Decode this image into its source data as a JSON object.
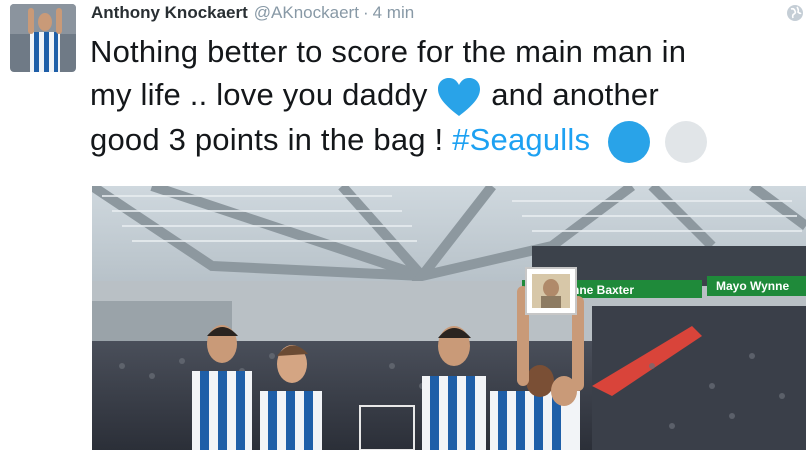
{
  "tweet": {
    "display_name": "Anthony Knockaert",
    "handle": "@AKnockaert",
    "separator": "·",
    "time": "4 min",
    "text_line1": "Nothing better to score for the main man in",
    "text_line2a": "my life .. love you daddy",
    "text_line2b": "and another",
    "text_line3a": "good 3 points in the bag !",
    "hashtag": "#Seagulls",
    "emojis": [
      "blue-heart",
      "blue-circle",
      "white-circle"
    ]
  },
  "photo": {
    "banner_left": "nne Baxter",
    "banner_right": "Mayo Wynne"
  },
  "colors": {
    "hashtag": "#1da1f2",
    "emoji_blue": "#29a3e8",
    "emoji_white": "#e1e5e8",
    "stand_green": "#1f8a3a",
    "kit_blue": "#1f5fa8"
  }
}
